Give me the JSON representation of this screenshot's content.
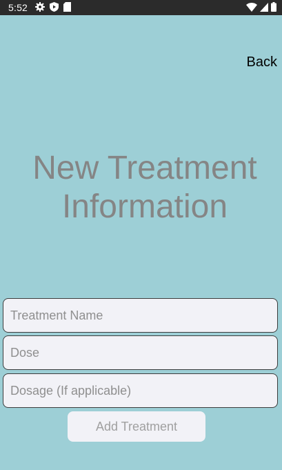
{
  "status_bar": {
    "time": "5:52",
    "left_icons": [
      "settings-icon",
      "shield-play-icon",
      "sd-card-icon"
    ],
    "right_icons": [
      "wifi-icon",
      "signal-icon",
      "battery-icon"
    ]
  },
  "header": {
    "back_label": "Back"
  },
  "main": {
    "title": "New Treatment\nInformation",
    "fields": {
      "treatment_name": {
        "placeholder": "Treatment Name",
        "value": ""
      },
      "dose": {
        "placeholder": "Dose",
        "value": ""
      },
      "dosage": {
        "placeholder": "Dosage (If applicable)",
        "value": ""
      }
    },
    "add_button_label": "Add Treatment"
  },
  "colors": {
    "background": "#9dcfd6",
    "status_bar": "#2b2b2b",
    "title_text": "#858585",
    "field_background": "#f2f2f7",
    "button_text": "#a0a0a0"
  }
}
